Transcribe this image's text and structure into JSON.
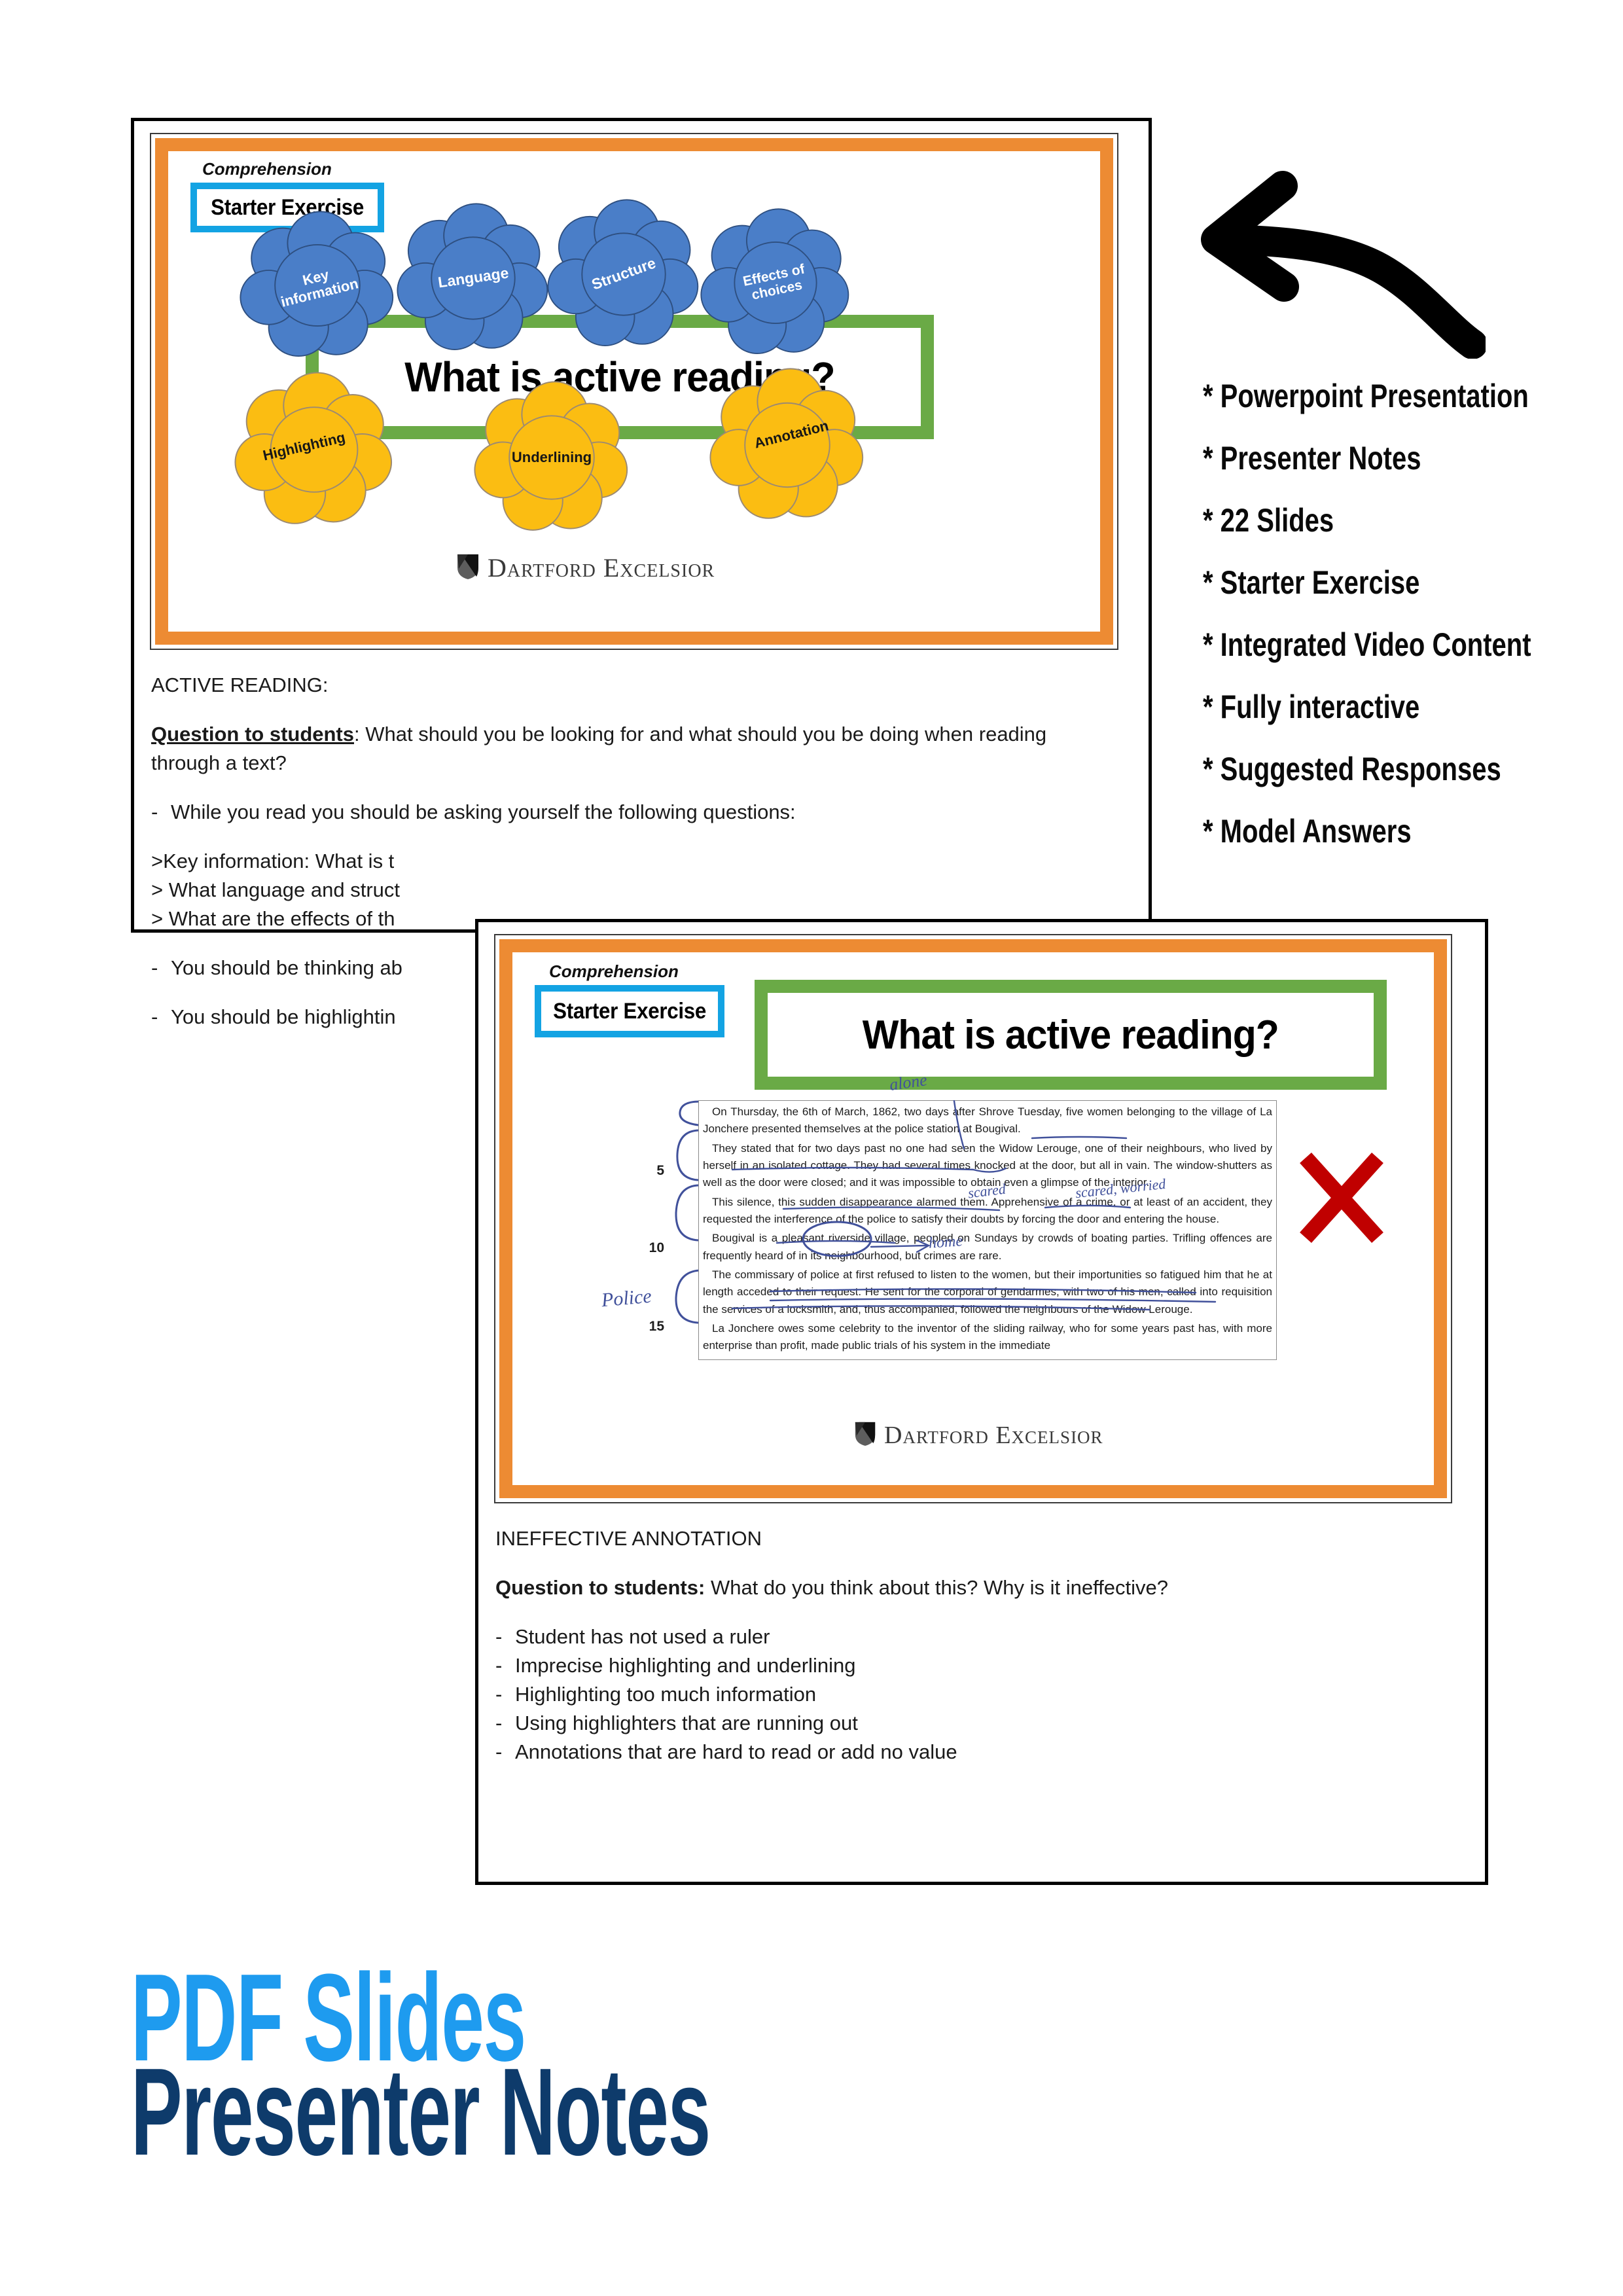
{
  "page": {
    "colors": {
      "orange_frame": "#ED8B33",
      "green_band": "#6AAA46",
      "cyan_box": "#13A3E3",
      "cloud_blue": "#4A7EC8",
      "cloud_yellow": "#FBBD12",
      "highlight_pink": "#F9A8D4",
      "pen_blue": "#41519B",
      "red_x": "#C00000",
      "title_blue": "#1E9BEF",
      "title_navy": "#0E3B6B"
    }
  },
  "slide1": {
    "kicker": "Comprehension",
    "badge": "Starter Exercise",
    "title": "What is active reading?",
    "clouds_blue": [
      {
        "label": "Key\ninformation",
        "rotate": -14
      },
      {
        "label": "Language",
        "rotate": -8
      },
      {
        "label": "Structure",
        "rotate": -18
      },
      {
        "label": "Effects of\nchoices",
        "rotate": -12
      }
    ],
    "clouds_yellow": [
      {
        "label": "Highlighting",
        "rotate": -13
      },
      {
        "label": "Underlining",
        "rotate": 0
      },
      {
        "label": "Annotation",
        "rotate": -14
      }
    ],
    "logo": "Dartford Excelsior"
  },
  "notes1": {
    "heading": "ACTIVE READING:",
    "question_label": "Question to students",
    "question_text": ": What should you be looking for and what should you be doing when reading through a text?",
    "bullet1": "While you read you should be asking yourself the following questions:",
    "sub1": ">Key information: What is t",
    "sub2": "> What language and struct",
    "sub3": "> What are the effects of th",
    "bullet2": "You should be thinking ab",
    "bullet3": "You should be highlightin",
    "dash": "-"
  },
  "features": {
    "items": [
      "* Powerpoint Presentation",
      "* Presenter Notes",
      "* 22 Slides",
      "* Starter Exercise",
      "* Integrated Video Content",
      "* Fully interactive",
      "* Suggested Responses",
      "* Model Answers"
    ]
  },
  "slide2": {
    "kicker": "Comprehension",
    "badge": "Starter Exercise",
    "title": "What is active reading?",
    "logo": "Dartford Excelsior",
    "line_numbers": [
      "5",
      "10",
      "15"
    ],
    "handwritten": [
      "alone",
      "scared",
      "scared, worried",
      "home",
      "Police"
    ],
    "passage": [
      "On Thursday, the 6th of March, 1862, two days after Shrove Tuesday, five women belonging to the village of La Jonchere presented themselves at the police station at Bougival.",
      "They stated that for two days past no one had seen the Widow Lerouge, one of their neighbours, who lived by herself in an isolated cottage. They had several times knocked at the door, but all in vain. The window-shutters as well as the door were closed; and it was impossible to obtain even a glimpse of the interior.",
      "This silence, this sudden disappearance alarmed them. Apprehensive of a crime, or at least of an accident, they requested the interference of the police to satisfy their doubts by forcing the door and entering the house.",
      "Bougival is a pleasant riverside village, peopled on Sundays by crowds of boating parties. Trifling offences are frequently heard of in its neighbourhood, but crimes are rare.",
      "The commissary of police at first refused to listen to the women, but their importunities so fatigued him that he at length acceded to their request. He sent for the corporal of gendarmes, with two of his men, called into requisition the services of a locksmith, and, thus accompanied, followed the neighbours of the Widow Lerouge.",
      "La Jonchere owes some celebrity to the inventor of the sliding railway, who for some years past has, with more enterprise than profit, made public trials of his system in the immediate"
    ]
  },
  "notes2": {
    "heading": "INEFFECTIVE ANNOTATION",
    "question_label": "Question to students:",
    "question_text": " What do you think about this? Why is it ineffective?",
    "dash": "-",
    "bullets": [
      "Student has not used a ruler",
      "Imprecise highlighting and underlining",
      "Highlighting too much information",
      "Using highlighters that are running out",
      "Annotations that are hard to read or add no value"
    ]
  },
  "bottom": {
    "line1": "PDF Slides",
    "line2": "Presenter Notes"
  }
}
